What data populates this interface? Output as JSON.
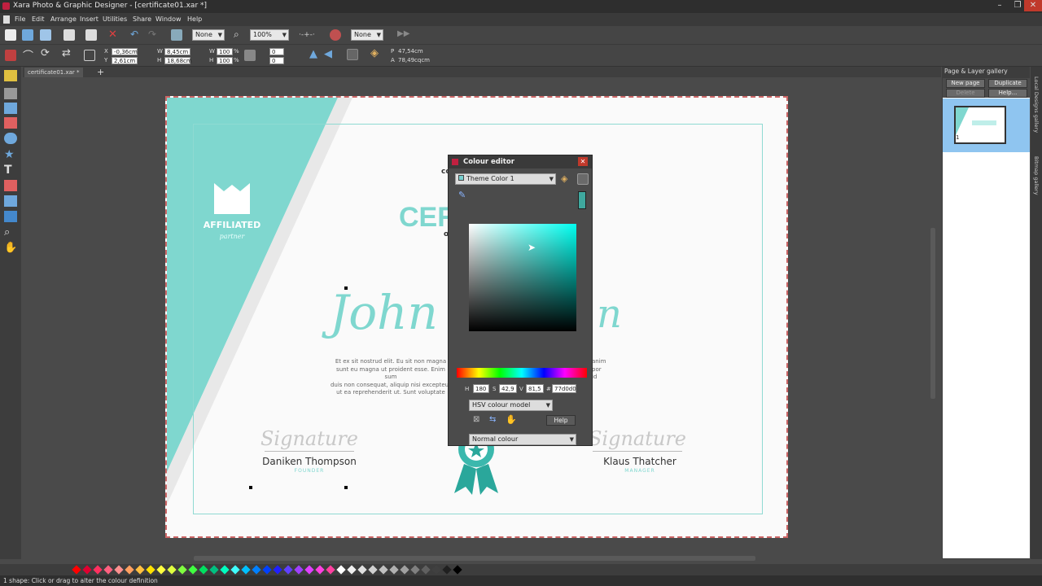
{
  "app": {
    "title": "Xara Photo & Graphic Designer - [certificate01.xar *]",
    "window_controls": [
      "–",
      "❐",
      "✕"
    ]
  },
  "menu": [
    "File",
    "Edit",
    "Arrange",
    "Insert",
    "Utilities",
    "Share",
    "Window",
    "Help"
  ],
  "toolbar": {
    "quality_select": "None",
    "zoom_value": "100%",
    "snap_select": "None"
  },
  "infobar": {
    "x_value": "-0,36cm",
    "y_value": "2,61cm",
    "w_value": "8,45cm",
    "h_value": "18,68cm",
    "scale_w": "100",
    "scale_h": "100",
    "pct": "%",
    "angle_value": "0",
    "shear_value": "0",
    "pos_readout_p": "P",
    "pos_readout_a": "A",
    "pos_p_value": "47,54cm",
    "pos_a_value": "78,49cqcm"
  },
  "doc_tab": "certificate01.xar *",
  "certificate": {
    "brand_name": "AFFILIATED",
    "brand_tagline": "partner",
    "title_fragment": "CERT",
    "co_fragment": "co",
    "o_fragment": "o",
    "recipient_fragment": "John",
    "recipient_end": "n",
    "body_left": [
      "Et ex sit nostrud elit. Eu sit non magna",
      "sunt eu magna ut proident esse. Enim sum",
      "duis non consequat, aliquip nisi excepteur",
      "ut ea reprehenderit ut. Sunt voluptate"
    ],
    "body_right": [
      "anim",
      "por",
      "id",
      ""
    ],
    "signature_word": "Signature",
    "signer_left_name": "Daniken Thompson",
    "signer_left_role": "FOUNDER",
    "signer_right_name": "Klaus Thatcher",
    "signer_right_role": "MANAGER"
  },
  "colour_editor": {
    "title": "Colour editor",
    "colour_name": "Theme Color 1",
    "h_label": "H",
    "h_value": "180",
    "s_label": "S",
    "s_value": "42,9",
    "v_label": "V",
    "v_value": "81,5",
    "hash_label": "#",
    "hex_value": "77d0d0",
    "model_select": "HSV colour model",
    "help_label": "Help",
    "type_select": "Normal colour",
    "accent": "#77d0d0"
  },
  "gallery": {
    "title": "Page & Layer gallery",
    "new_page": "New page",
    "duplicate": "Duplicate",
    "delete": "Delete",
    "help": "Help...",
    "page_number": "1"
  },
  "side_tabs": [
    "Local Designs gallery",
    "Bitmap gallery"
  ],
  "status": {
    "text": "1 shape: Click or drag to alter the colour definition"
  },
  "colors": {
    "teal": "#7fd7cf",
    "accent_red": "#c02040"
  },
  "palette_colors": [
    "#ff0000",
    "#e00030",
    "#ff3060",
    "#ff6080",
    "#ff9090",
    "#ffa060",
    "#ffc040",
    "#ffe000",
    "#ffff40",
    "#e0ff40",
    "#80ff40",
    "#40ff40",
    "#00e060",
    "#00c080",
    "#00ffc0",
    "#40ffff",
    "#00c0ff",
    "#0080ff",
    "#0040ff",
    "#2020ff",
    "#6040ff",
    "#a040ff",
    "#e040ff",
    "#ff40e0",
    "#ff40a0",
    "#ffffff",
    "#f0f0f0",
    "#e0e0e0",
    "#d0d0d0",
    "#c0c0c0",
    "#b0b0b0",
    "#a0a0a0",
    "#808080",
    "#606060",
    "#404040",
    "#202020",
    "#000000"
  ]
}
